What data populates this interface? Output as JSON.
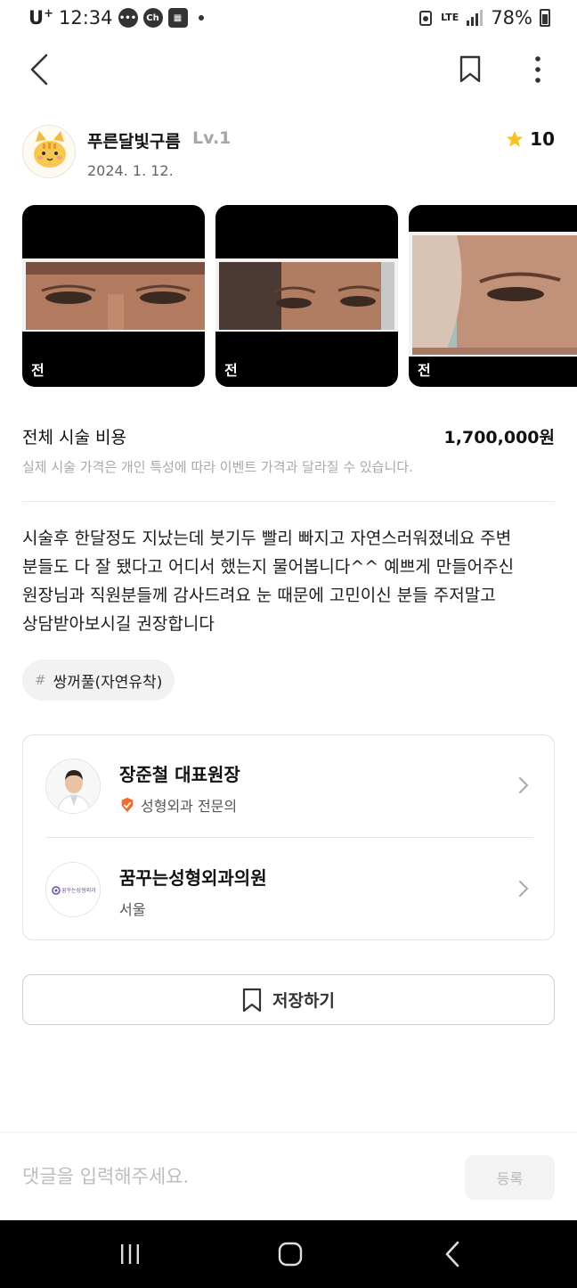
{
  "status_bar": {
    "carrier": "U",
    "carrier_sup": "+",
    "time": "12:34",
    "ch_icon_label": "Ch",
    "network": "LTE",
    "battery": "78%"
  },
  "author": {
    "name": "푸른달빛구름",
    "level": "Lv.1",
    "date": "2024. 1. 12.",
    "rating": "10"
  },
  "photos": [
    {
      "label": "전"
    },
    {
      "label": "전"
    },
    {
      "label": "전"
    }
  ],
  "price": {
    "label": "전체 시술 비용",
    "value": "1,700,000원",
    "note": "실제 시술 가격은 개인 특성에 따라 이벤트 가격과 달라질 수 있습니다."
  },
  "review": {
    "lines": [
      "시술후 한달정도 지났는데 붓기두 빨리 빠지고 자연스러워졌네요 주변",
      "분들도 다 잘 됐다고 어디서 했는지 물어봅니다^^ 예쁘게 만들어주신",
      "원장님과 직원분들께 감사드려요 눈 때문에 고민이신 분들 주저말고",
      "상담받아보시길 권장합니다"
    ]
  },
  "tag": {
    "hash": "#",
    "label": "쌍꺼풀(자연유착)"
  },
  "doctor": {
    "name": "장준철 대표원장",
    "specialty": "성형외과 전문의"
  },
  "hospital": {
    "name": "꿈꾸는성형외과의원",
    "logo_text": "꿈꾸는성형외과",
    "location": "서울"
  },
  "save_button": {
    "label": "저장하기"
  },
  "comment": {
    "placeholder": "댓글을 입력해주세요.",
    "submit_label": "등록"
  },
  "colors": {
    "star": "#F7C321",
    "badge": "#F26B2B",
    "nav_bg": "#000000"
  },
  "icons": {
    "back": "back-arrow-icon",
    "bookmark": "bookmark-icon",
    "more": "more-vertical-icon",
    "star": "star-icon",
    "chevron": "chevron-right-icon"
  }
}
